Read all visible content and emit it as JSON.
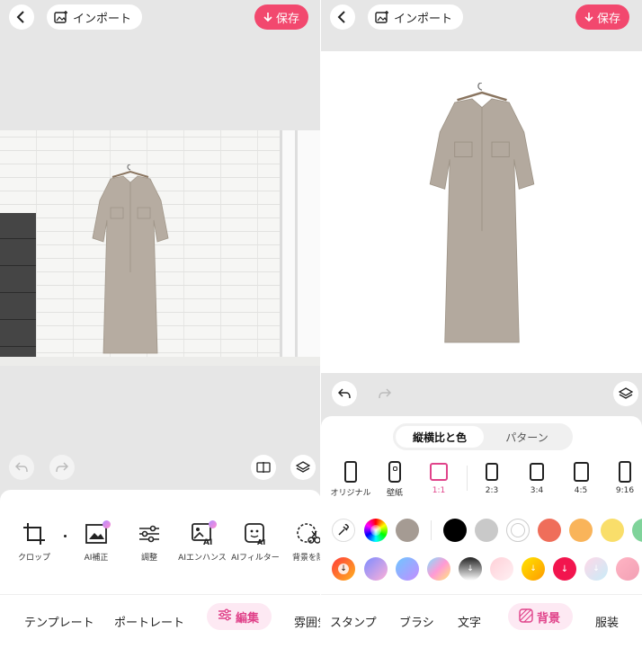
{
  "common": {
    "import_label": "インポート",
    "save_label": "保存"
  },
  "left": {
    "tools": [
      {
        "label": "クロップ",
        "icon": "crop-icon"
      },
      {
        "label": "AI補正",
        "icon": "ai-correct-icon"
      },
      {
        "label": "調整",
        "icon": "adjust-sliders-icon"
      },
      {
        "label": "AIエンハンス",
        "icon": "ai-enhance-icon"
      },
      {
        "label": "AIフィルター",
        "icon": "ai-filter-icon"
      },
      {
        "label": "背景を除",
        "icon": "remove-bg-icon"
      }
    ],
    "tabs": [
      "テンプレート",
      "ポートレート",
      "編集",
      "雰囲気"
    ],
    "active_tab": "編集"
  },
  "right": {
    "segment": {
      "active": "縦横比と色",
      "inactive": "パターン"
    },
    "ratios": [
      "オリジナル",
      "壁紙",
      "1:1",
      "2:3",
      "3:4",
      "4:5",
      "9:16"
    ],
    "selected_ratio": "1:1",
    "colors_row1": [
      "#000000",
      "#c9c9c9",
      "#ffffff",
      "#ef6e5a",
      "#f9b45a",
      "#f9de6a",
      "#7fd39a"
    ],
    "tabs": [
      "スタンプ",
      "ブラシ",
      "文字",
      "背景",
      "服装"
    ],
    "active_tab": "背景"
  },
  "colors": {
    "accent": "#f2486e",
    "pink": "#e0438a"
  }
}
